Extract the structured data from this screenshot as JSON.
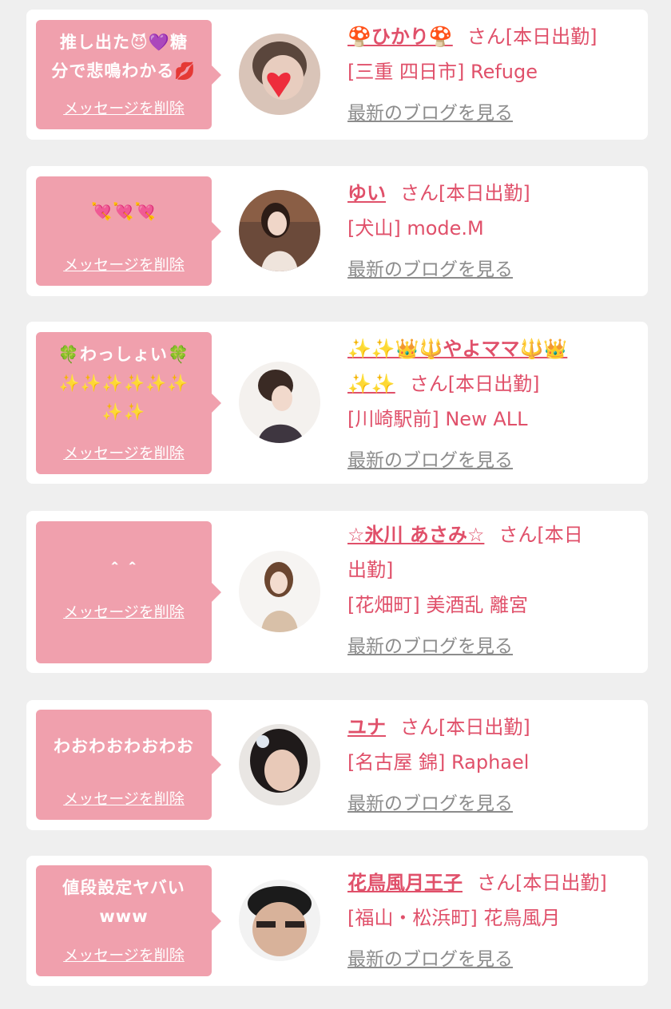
{
  "common": {
    "delete_label": "メッセージを削除",
    "blog_label": "最新のブログを見る"
  },
  "cards": [
    {
      "message_lines": [
        "推し出た😈💜糖",
        "分で悲鳴わかる💋"
      ],
      "name": "🍄ひかり🍄",
      "suffix": "さん[本日出勤]",
      "shop": "[三重 四日市] Refuge"
    },
    {
      "message_lines": [
        "💘💘💘"
      ],
      "name": "ゆい",
      "suffix": "さん[本日出勤]",
      "shop": "[犬山] mode.M"
    },
    {
      "message_lines": [
        "🍀わっしょい🍀",
        "✨✨✨✨✨✨",
        "✨✨"
      ],
      "name_line1": "✨✨👑🔱やよママ🔱👑",
      "name_line2": "✨✨",
      "suffix": "さん[本日出勤]",
      "shop": "[川崎駅前] New ALL"
    },
    {
      "message_lines": [
        "＾＾"
      ],
      "name": "☆氷川 あさみ☆",
      "suffix_line1": "さん[本日",
      "suffix_line2": "出勤]",
      "shop": "[花畑町] 美酒乱 離宮"
    },
    {
      "message_lines": [
        "わおわおわおわお"
      ],
      "name": "ユナ",
      "suffix": "さん[本日出勤]",
      "shop": "[名古屋 錦] Raphael"
    },
    {
      "message_lines": [
        "値段設定ヤバい",
        "www"
      ],
      "name": "花鳥風月王子",
      "suffix": "さん[本日出勤]",
      "shop": "[福山・松浜町] 花鳥風月"
    }
  ],
  "colors": {
    "bubble": "#f0a0ad",
    "accent_text": "#e0506a",
    "link_gray": "#8c8c8c",
    "page_bg": "#efefef"
  }
}
